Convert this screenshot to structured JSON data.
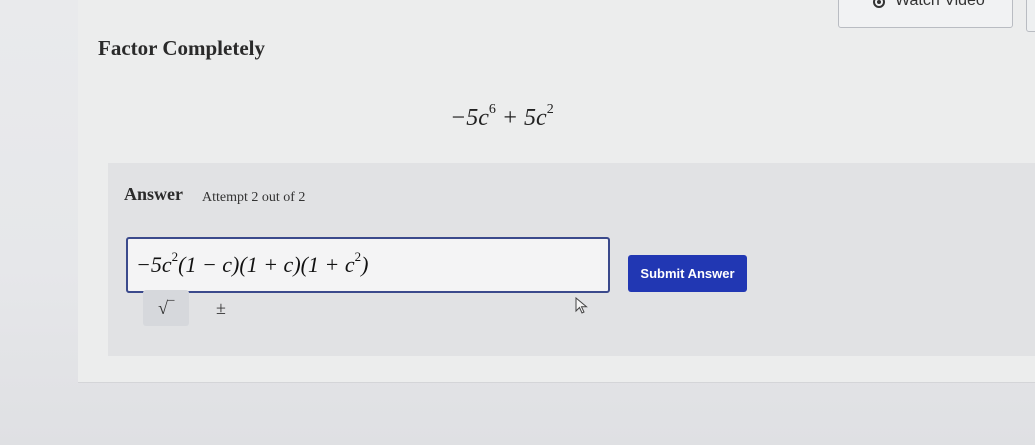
{
  "header": {
    "watch_video_label": "Watch Video",
    "watch_video_icon": "play-circle-icon"
  },
  "problem": {
    "title": "Factor Completely",
    "expr_coef1": "−5c",
    "expr_exp1": "6",
    "expr_mid": " + 5c",
    "expr_exp2": "2"
  },
  "answer": {
    "label": "Answer",
    "attempt": "Attempt 2 out of 2",
    "input_lead": "−5c",
    "input_exp1": "2",
    "input_body": "(1 − c)(1 + c)(1 + c",
    "input_exp2": "2",
    "input_tail": ")",
    "submit_label": "Submit Answer",
    "tools": [
      {
        "label": "√‾",
        "icon": "square-root-icon"
      },
      {
        "label": "±",
        "icon": "plus-minus-icon"
      }
    ]
  },
  "colors": {
    "accent": "#2137b3",
    "input_border": "#3b4a8c"
  }
}
